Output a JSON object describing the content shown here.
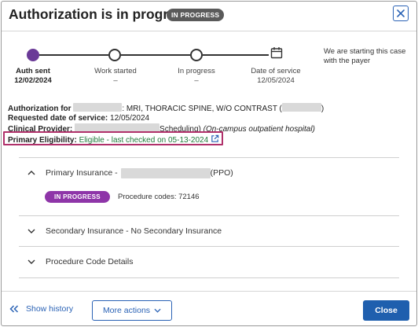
{
  "header": {
    "title": "Authorization is in progress",
    "status_badge": "IN PROGRESS"
  },
  "stepper": {
    "steps": [
      {
        "label": "Auth sent",
        "sub": "12/02/2024",
        "state": "done",
        "icon": "filled-circle-icon"
      },
      {
        "label": "Work started",
        "sub": "–",
        "state": "pending",
        "icon": "circle-icon"
      },
      {
        "label": "In progress",
        "sub": "–",
        "state": "pending",
        "icon": "circle-icon"
      },
      {
        "label": "Date of service",
        "sub": "12/05/2024",
        "state": "pending",
        "icon": "calendar-icon"
      }
    ],
    "side_note": "We are starting this case with the payer"
  },
  "info": {
    "auth_for_label": "Authorization for",
    "auth_for_value": ": MRI, THORACIC SPINE, W/O CONTRAST (",
    "auth_for_tail": ")",
    "requested_label": "Requested date of service:",
    "requested_value": "12/05/2024",
    "provider_label": "Clinical Provider:",
    "provider_value": "Scheduling)",
    "provider_note": "(On-campus outpatient hospital)",
    "eligibility_label": "Primary Eligibility:",
    "eligibility_value": "Eligible - last checked on 05-13-2024"
  },
  "accordion": {
    "primary_label": "Primary Insurance -",
    "primary_suffix": "(PPO)",
    "primary_badge": "IN PROGRESS",
    "procedure_codes": "Procedure codes: 72146",
    "secondary_label": "Secondary Insurance - No Secondary Insurance",
    "procedure_label": "Procedure Code Details"
  },
  "footer": {
    "show_history": "Show history",
    "more_actions": "More actions",
    "close": "Close"
  },
  "colors": {
    "accent_blue": "#1f5fae",
    "progress_purple": "#8e35a8",
    "step_done": "#6a3a97",
    "eligible_green": "#1f7a3a",
    "highlight_border": "#b0306a"
  }
}
